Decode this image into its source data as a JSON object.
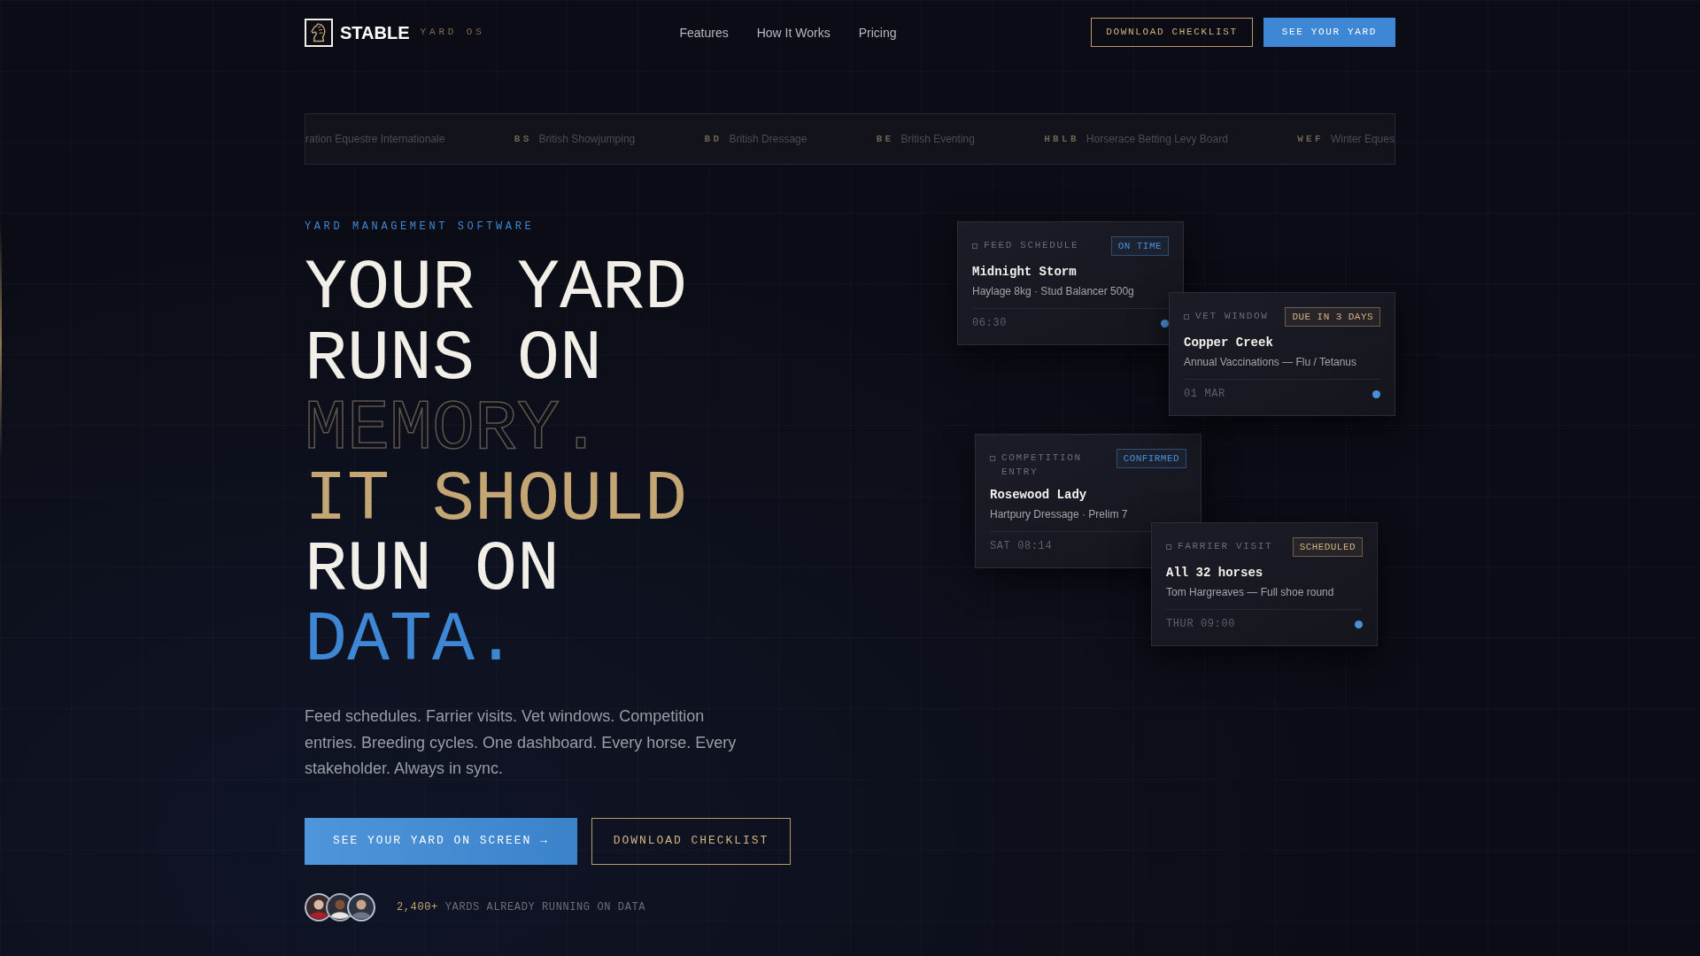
{
  "header": {
    "logo": {
      "name": "STABLE",
      "tagline": "YARD OS"
    },
    "nav": [
      {
        "label": "Features"
      },
      {
        "label": "How It Works"
      },
      {
        "label": "Pricing"
      }
    ],
    "buttons": [
      {
        "label": "DOWNLOAD CHECKLIST",
        "kind": "outline"
      },
      {
        "label": "SEE YOUR YARD",
        "kind": "primary"
      }
    ]
  },
  "partner_strip": [
    {
      "name": "ration Equestre Internationale"
    },
    {
      "abbr": "BS",
      "name": "British Showjumping"
    },
    {
      "abbr": "BD",
      "name": "British Dressage"
    },
    {
      "abbr": "BE",
      "name": "British Eventing"
    },
    {
      "abbr": "HBLB",
      "name": "Horserace Betting Levy Board"
    },
    {
      "abbr": "WEF",
      "name": "Winter Eques"
    }
  ],
  "hero": {
    "eyebrow": "YARD MANAGEMENT SOFTWARE",
    "headline": [
      {
        "text": "YOUR YARD",
        "kind": "solid"
      },
      {
        "text": "RUNS ON",
        "kind": "solid"
      },
      {
        "text": "MEMORY.",
        "kind": "outline"
      },
      {
        "text": "IT SHOULD",
        "kind": "gold"
      },
      {
        "text": "RUN ON",
        "kind": "solid"
      },
      {
        "text": "DATA.",
        "kind": "blue"
      }
    ],
    "description": "Feed schedules. Farrier visits. Vet windows. Competition entries. Breeding cycles. One dashboard. Every horse. Every stakeholder. Always in sync.",
    "buttons": [
      {
        "label": "SEE YOUR YARD ON SCREEN →",
        "kind": "primary"
      },
      {
        "label": "DOWNLOAD CHECKLIST",
        "kind": "outline"
      }
    ],
    "social_proof": {
      "count": "2,400+",
      "text": "YARDS ALREADY RUNNING ON DATA"
    }
  },
  "cards": [
    {
      "label": "FEED SCHEDULE",
      "status": {
        "text": "ON TIME",
        "color": "#4a90d9"
      },
      "title": "Midnight Storm",
      "detail": "Haylage 8kg · Stud Balancer 500g",
      "time": "06:30"
    },
    {
      "label": "VET WINDOW",
      "status": {
        "text": "DUE IN 3 DAYS",
        "color": "#d4b483"
      },
      "title": "Copper Creek",
      "detail": "Annual Vaccinations — Flu / Tetanus",
      "time": "01 MAR"
    },
    {
      "label": "COMPETITION ENTRY",
      "status": {
        "text": "CONFIRMED",
        "color": "#4a90d9"
      },
      "title": "Rosewood Lady",
      "detail": "Hartpury Dressage · Prelim 7",
      "time": "SAT 08:14"
    },
    {
      "label": "FARRIER VISIT",
      "status": {
        "text": "SCHEDULED",
        "color": "#d4b483"
      },
      "title": "All 32 horses",
      "detail": "Tom Hargreaves — Full shoe round",
      "time": "THUR 09:00"
    }
  ]
}
